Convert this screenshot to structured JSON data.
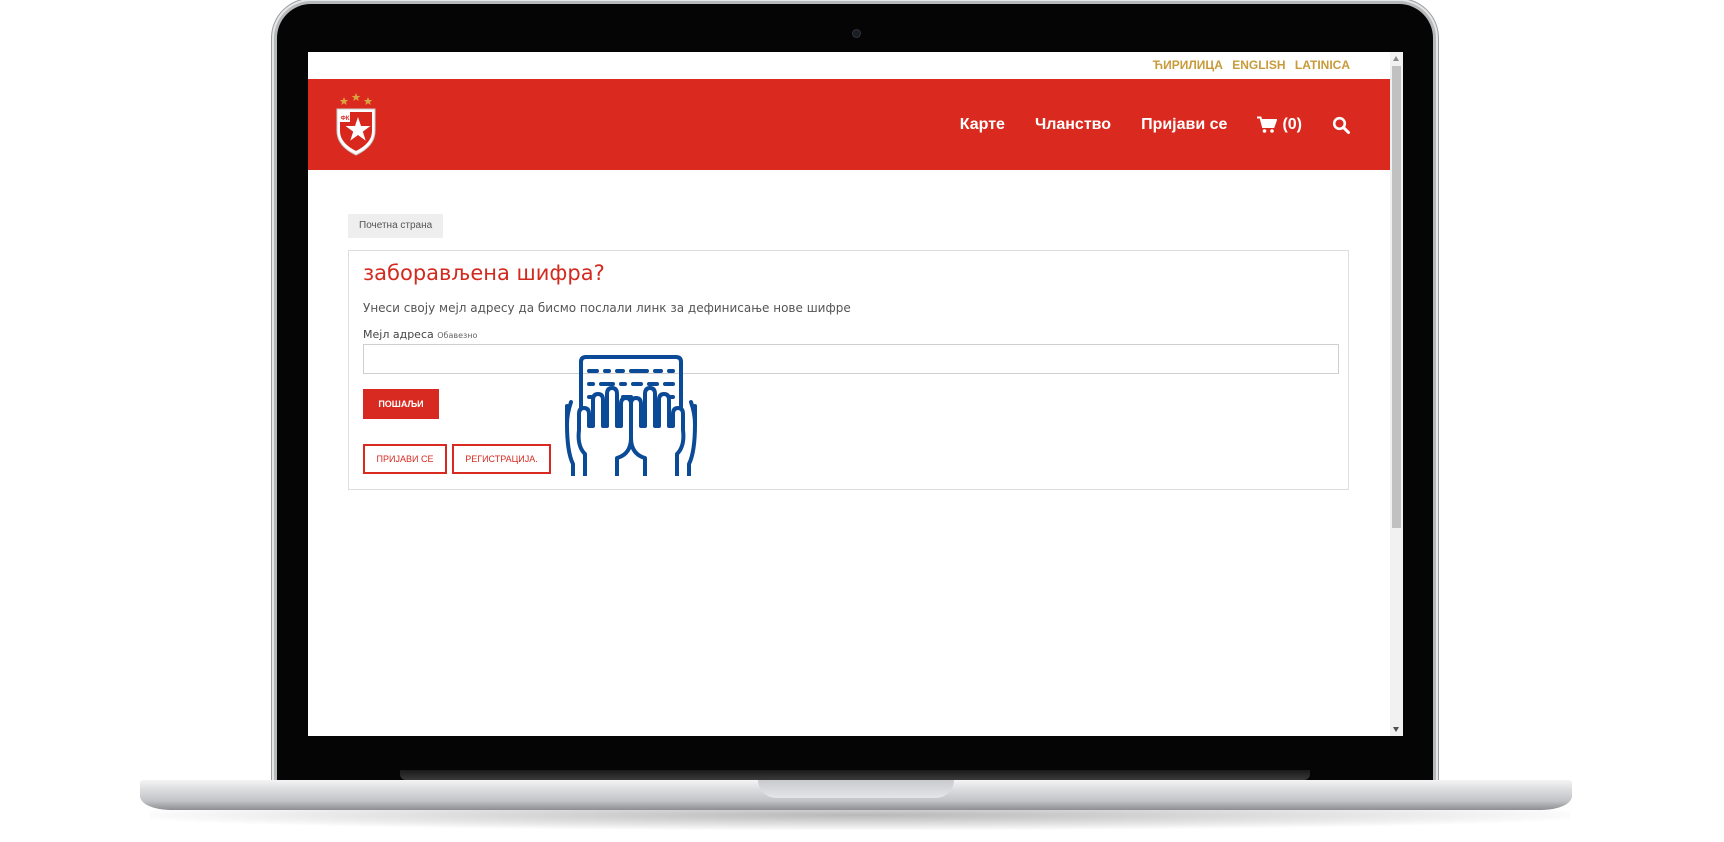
{
  "lang": {
    "items": [
      "ЋИРИЛИЦА",
      "ENGLISH",
      "LATINICA"
    ]
  },
  "nav": {
    "items": [
      "Карте",
      "Чланство",
      "Пријави се"
    ],
    "cart": "(0)"
  },
  "breadcrumb": "Почетна страна",
  "form": {
    "title": "заборављена шифра?",
    "description": "Унеси своју мејл адресу да бисмо послали линк за дефинисање нове шифре",
    "email_label": "Мејл адреса",
    "required_label": "Обавезно",
    "email_value": "",
    "send_button": "ПОШАЉИ",
    "login_button": "ПРИЈАВИ СЕ",
    "register_button": "РЕГИСТРАЦИЈА."
  },
  "colors": {
    "brand_red": "#da2a1f",
    "lang_gold": "#c89a3a",
    "overlay_blue": "#0b4a96"
  },
  "icons": {
    "logo": "red-star-shield-logo",
    "cart": "shopping-cart-icon",
    "search": "search-icon",
    "overlay": "keyboard-typing-hands-icon"
  }
}
